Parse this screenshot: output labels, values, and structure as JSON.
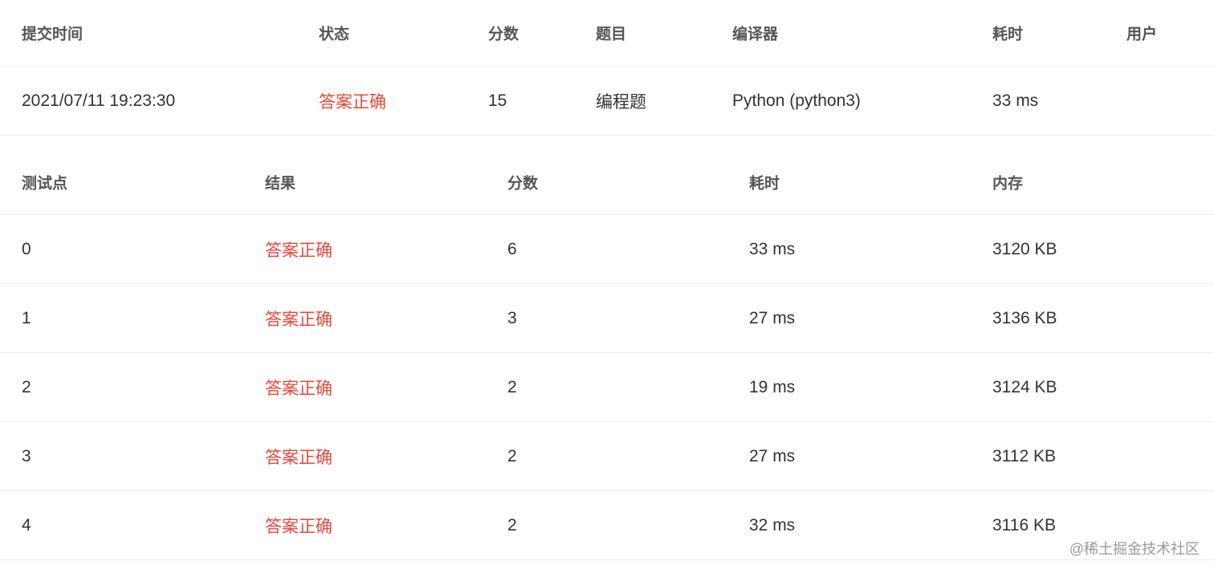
{
  "submission": {
    "headers": {
      "time": "提交时间",
      "status": "状态",
      "score": "分数",
      "problem": "题目",
      "compiler": "编译器",
      "cost": "耗时",
      "user": "用户"
    },
    "row": {
      "time": "2021/07/11 19:23:30",
      "status": "答案正确",
      "score": "15",
      "problem": "编程题",
      "compiler": "Python (python3)",
      "cost": "33 ms",
      "user": ""
    }
  },
  "testcases": {
    "headers": {
      "id": "测试点",
      "result": "结果",
      "score": "分数",
      "cost": "耗时",
      "memory": "内存"
    },
    "rows": [
      {
        "id": "0",
        "result": "答案正确",
        "score": "6",
        "cost": "33 ms",
        "memory": "3120 KB"
      },
      {
        "id": "1",
        "result": "答案正确",
        "score": "3",
        "cost": "27 ms",
        "memory": "3136 KB"
      },
      {
        "id": "2",
        "result": "答案正确",
        "score": "2",
        "cost": "19 ms",
        "memory": "3124 KB"
      },
      {
        "id": "3",
        "result": "答案正确",
        "score": "2",
        "cost": "27 ms",
        "memory": "3112 KB"
      },
      {
        "id": "4",
        "result": "答案正确",
        "score": "2",
        "cost": "32 ms",
        "memory": "3116 KB"
      }
    ]
  },
  "colors": {
    "accepted": "#e9483c",
    "divider": "#ececec"
  },
  "watermark": "@稀土掘金技术社区"
}
